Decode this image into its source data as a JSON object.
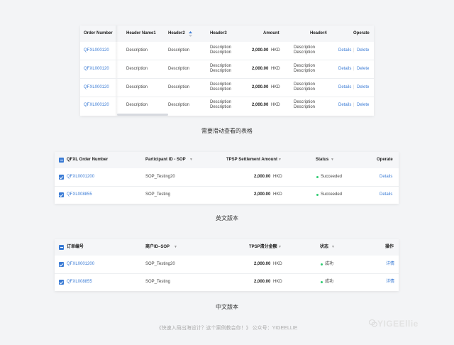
{
  "table1": {
    "headers": [
      "Order Number",
      "Header Name1",
      "Header2",
      "Header3",
      "Amount",
      "Header4",
      "Operate"
    ],
    "rows": [
      {
        "order": "QFXL000120",
        "h1": "Description",
        "h2": "Description",
        "h3a": "Description",
        "h3b": "Description",
        "amount": "2,000.00",
        "currency": "HKD",
        "h4a": "Description",
        "h4b": "Description",
        "details": "Details",
        "delete": "Delete"
      },
      {
        "order": "QFXL000120",
        "h1": "Description",
        "h2": "Description",
        "h3a": "Description",
        "h3b": "Description",
        "amount": "2,000.00",
        "currency": "HKD",
        "h4a": "Description",
        "h4b": "Description",
        "details": "Details",
        "delete": "Delete"
      },
      {
        "order": "QFXL000120",
        "h1": "Description",
        "h2": "Description",
        "h3a": "Description",
        "h3b": "Description",
        "amount": "2,000.00",
        "currency": "HKD",
        "h4a": "Description",
        "h4b": "Description",
        "details": "Details",
        "delete": "Delete"
      },
      {
        "order": "QFXL000120",
        "h1": "Description",
        "h2": "Description",
        "h3a": "Description",
        "h3b": "Description",
        "amount": "2,000.00",
        "currency": "HKD",
        "h4a": "Description",
        "h4b": "Description",
        "details": "Details",
        "delete": "Delete"
      }
    ],
    "caption": "需要滑动查看的表格"
  },
  "table2": {
    "headers": [
      "QFXL Order Number",
      "Participant ID - SOP",
      "TPSP Settlement Amount",
      "Status",
      "Operate"
    ],
    "rows": [
      {
        "order": "QFXL0001200",
        "participant": "SOP_Testing20",
        "amount": "2,000.00",
        "currency": "HKD",
        "status": "Succeeded",
        "action": "Details"
      },
      {
        "order": "QFXL008855",
        "participant": "SOP_Testing",
        "amount": "2,000.00",
        "currency": "HKD",
        "status": "Succeeded",
        "action": "Details"
      }
    ],
    "caption": "英文版本"
  },
  "table3": {
    "headers": [
      "订单编号",
      "商户ID–SOP",
      "TPSP清分金额",
      "状态",
      "操作"
    ],
    "rows": [
      {
        "order": "QFXL0001200",
        "participant": "SOP_Testing20",
        "amount": "2,000.00",
        "currency": "HKD",
        "status": "成功",
        "action": "详情"
      },
      {
        "order": "QFXL008855",
        "participant": "SOP_Testing",
        "amount": "2,000.00",
        "currency": "HKD",
        "status": "成功",
        "action": "详情"
      }
    ],
    "caption": "中文版本"
  },
  "footer": {
    "text": "《快速入局出海设计？这个案例教会你！》 公众号：YIGEELLIE",
    "logo": "YIGEEllie"
  },
  "colors": {
    "link": "#3a7bd5",
    "success": "#2ecc71",
    "background": "#f3f4f6"
  }
}
